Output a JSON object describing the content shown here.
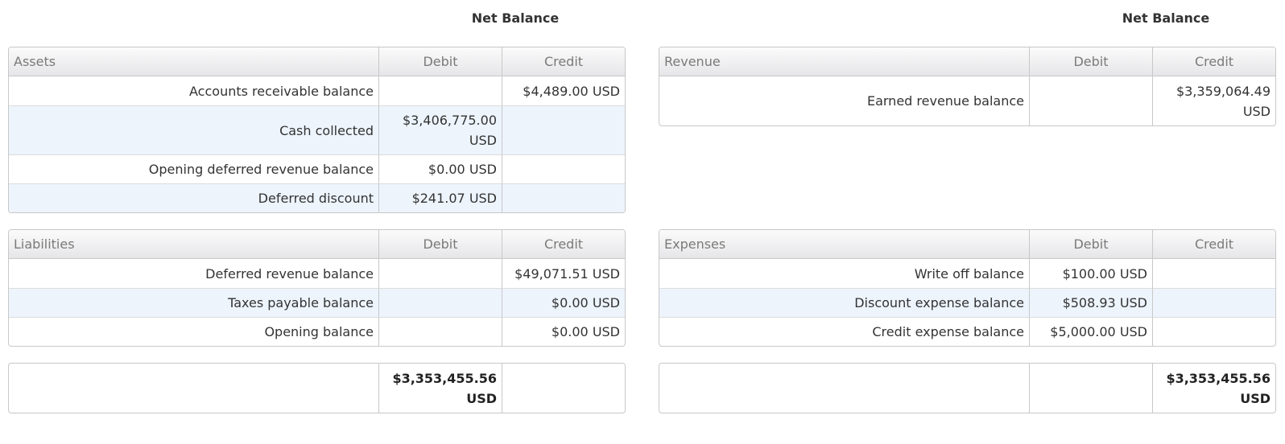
{
  "left": {
    "net_balance_title": "Net Balance",
    "assets": {
      "header": {
        "name": "Assets",
        "debit": "Debit",
        "credit": "Credit"
      },
      "rows": [
        {
          "name": "Accounts receivable balance",
          "debit": "",
          "credit": "$4,489.00 USD"
        },
        {
          "name": "Cash collected",
          "debit": "$3,406,775.00 USD",
          "credit": ""
        },
        {
          "name": "Opening deferred revenue balance",
          "debit": "$0.00 USD",
          "credit": ""
        },
        {
          "name": "Deferred discount",
          "debit": "$241.07 USD",
          "credit": ""
        }
      ]
    },
    "liabilities": {
      "header": {
        "name": "Liabilities",
        "debit": "Debit",
        "credit": "Credit"
      },
      "rows": [
        {
          "name": "Deferred revenue balance",
          "debit": "",
          "credit": "$49,071.51 USD"
        },
        {
          "name": "Taxes payable balance",
          "debit": "",
          "credit": "$0.00 USD"
        },
        {
          "name": "Opening balance",
          "debit": "",
          "credit": "$0.00 USD"
        }
      ]
    },
    "total": {
      "name": "",
      "debit": "$3,353,455.56 USD",
      "credit": ""
    }
  },
  "right": {
    "net_balance_title": "Net Balance",
    "revenue": {
      "header": {
        "name": "Revenue",
        "debit": "Debit",
        "credit": "Credit"
      },
      "rows": [
        {
          "name": "Earned revenue balance",
          "debit": "",
          "credit": "$3,359,064.49 USD"
        }
      ]
    },
    "expenses": {
      "header": {
        "name": "Expenses",
        "debit": "Debit",
        "credit": "Credit"
      },
      "rows": [
        {
          "name": "Write off balance",
          "debit": "$100.00 USD",
          "credit": ""
        },
        {
          "name": "Discount expense balance",
          "debit": "$508.93 USD",
          "credit": ""
        },
        {
          "name": "Credit expense balance",
          "debit": "$5,000.00 USD",
          "credit": ""
        }
      ]
    },
    "total": {
      "name": "",
      "debit": "",
      "credit": "$3,353,455.56 USD"
    }
  }
}
